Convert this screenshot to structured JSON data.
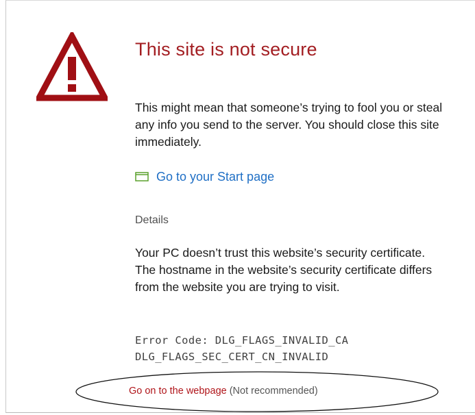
{
  "page": {
    "title": "This site is not secure",
    "message": "This might mean that someone’s trying to fool you or steal any info you send to the server. You should close this site immediately.",
    "start_link": {
      "icon": "start-page-icon",
      "label": "Go to your Start page"
    },
    "details": {
      "toggle_label": "Details",
      "lines": [
        "Your PC doesn’t trust this website’s security certificate.",
        "The hostname in the website’s security certificate differs from the website you are trying to visit."
      ]
    },
    "error_codes": [
      "Error Code: DLG_FLAGS_INVALID_CA",
      "DLG_FLAGS_SEC_CERT_CN_INVALID"
    ],
    "continue": {
      "link_label": "Go on to the webpage",
      "note": " (Not recommended)"
    }
  },
  "colors": {
    "title": "#a31e22",
    "warning_icon": "#a00f14",
    "link_blue": "#1f6fc5",
    "start_icon_green": "#5aa02c",
    "continue_link": "#b0151a"
  }
}
